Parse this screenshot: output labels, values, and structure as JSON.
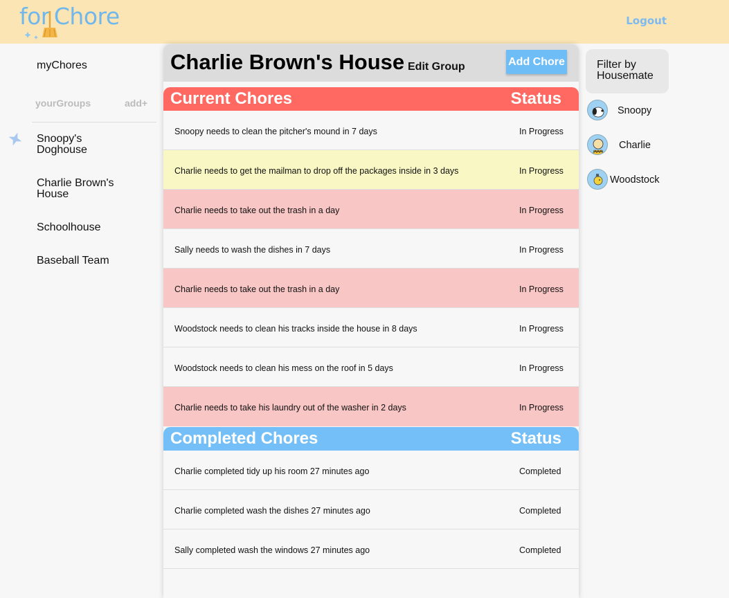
{
  "header": {
    "logo_prefix": "for",
    "logo_suffix": "Chore",
    "logout": "Logout"
  },
  "sidebar": {
    "my_chores": "myChores",
    "your_groups": "yourGroups",
    "add": "add+",
    "groups": [
      {
        "label_line1": "Snoopy's",
        "label_line2": "Doghouse"
      },
      {
        "label_line1": "Charlie Brown's",
        "label_line2": "House"
      },
      {
        "label_line1": "Schoolhouse",
        "label_line2": ""
      },
      {
        "label_line1": "Baseball Team",
        "label_line2": ""
      }
    ]
  },
  "main": {
    "group_title": "Charlie Brown's House",
    "edit_group": "Edit Group",
    "add_chore": "Add Chore",
    "current": {
      "title": "Current Chores",
      "status_header": "Status",
      "rows": [
        {
          "text": "Snoopy needs to clean the pitcher's mound in 7 days",
          "status": "In Progress",
          "tone": "normal"
        },
        {
          "text": "Charlie needs to get the mailman to drop off the packages inside in 3 days",
          "status": "In Progress",
          "tone": "yellow"
        },
        {
          "text": "Charlie needs to take out the trash in a day",
          "status": "In Progress",
          "tone": "red"
        },
        {
          "text": "Sally needs to wash the dishes in 7 days",
          "status": "In Progress",
          "tone": "normal"
        },
        {
          "text": "Charlie needs to take out the trash in a day",
          "status": "In Progress",
          "tone": "red"
        },
        {
          "text": "Woodstock needs to clean his tracks inside the house in 8 days",
          "status": "In Progress",
          "tone": "normal"
        },
        {
          "text": "Woodstock needs to clean his mess on the roof in 5 days",
          "status": "In Progress",
          "tone": "normal"
        },
        {
          "text": "Charlie needs to take his laundry out of the washer in 2 days",
          "status": "In Progress",
          "tone": "red"
        }
      ]
    },
    "completed": {
      "title": "Completed Chores",
      "status_header": "Status",
      "rows": [
        {
          "text": "Charlie completed tidy up his room 27 minutes ago",
          "status": "Completed"
        },
        {
          "text": "Charlie completed wash the dishes 27 minutes ago",
          "status": "Completed"
        },
        {
          "text": "Sally completed wash the windows 27 minutes ago",
          "status": "Completed"
        }
      ]
    }
  },
  "filter": {
    "title_line1": "Filter by",
    "title_line2": "Housemate",
    "housemates": [
      {
        "name": "Snoopy",
        "icon": "snoopy-avatar-icon"
      },
      {
        "name": "Charlie",
        "icon": "charlie-avatar-icon"
      },
      {
        "name": "Woodstock",
        "icon": "woodstock-avatar-icon"
      }
    ]
  },
  "colors": {
    "header_bg": "#fbe5b4",
    "accent_blue": "#74bff8",
    "current_red": "#ff6961",
    "row_red": "#f8c6c5",
    "row_yellow": "#f9f8c4"
  }
}
